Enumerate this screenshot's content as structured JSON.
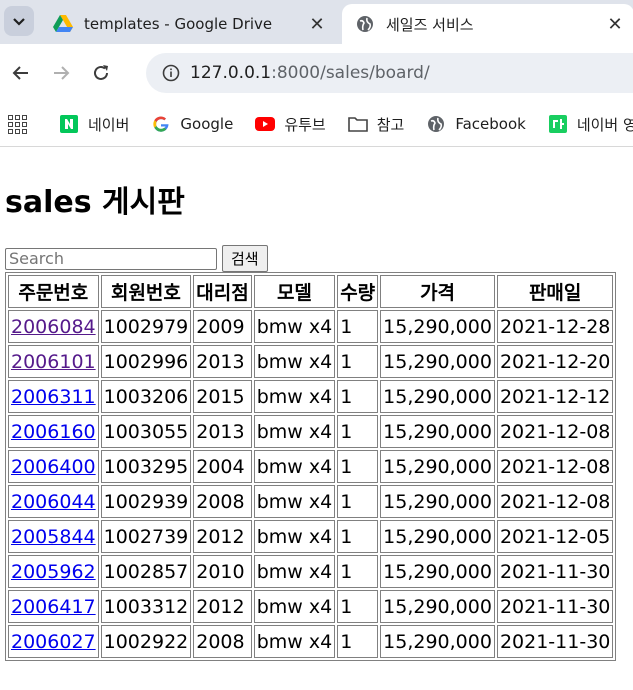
{
  "browser": {
    "tabs": [
      {
        "title": "templates - Google Drive",
        "favicon": "google-drive-icon",
        "active": false
      },
      {
        "title": "세일즈 서비스",
        "favicon": "globe-icon",
        "active": true
      }
    ],
    "url_host": "127.0.0.1",
    "url_rest": ":8000/sales/board/",
    "bookmarks": [
      {
        "label": "네이버",
        "icon": "naver-icon"
      },
      {
        "label": "Google",
        "icon": "google-icon"
      },
      {
        "label": "유투브",
        "icon": "youtube-icon"
      },
      {
        "label": "참고",
        "icon": "folder-icon"
      },
      {
        "label": "Facebook",
        "icon": "globe-icon"
      },
      {
        "label": "네이버 영",
        "icon": "naver-dict-icon"
      }
    ]
  },
  "page": {
    "title": "sales 게시판",
    "search": {
      "placeholder": "Search",
      "value": "",
      "button_label": "검색"
    },
    "table": {
      "headers": [
        "주문번호",
        "회원번호",
        "대리점",
        "모델",
        "수량",
        "가격",
        "판매일"
      ],
      "rows": [
        {
          "order_no": "2006084",
          "member_no": "1002979",
          "dealer": "2009",
          "model": "bmw x4",
          "qty": "1",
          "price": "15,290,000",
          "date": "2021-12-28",
          "visited": true
        },
        {
          "order_no": "2006101",
          "member_no": "1002996",
          "dealer": "2013",
          "model": "bmw x4",
          "qty": "1",
          "price": "15,290,000",
          "date": "2021-12-20",
          "visited": true
        },
        {
          "order_no": "2006311",
          "member_no": "1003206",
          "dealer": "2015",
          "model": "bmw x4",
          "qty": "1",
          "price": "15,290,000",
          "date": "2021-12-12",
          "visited": false
        },
        {
          "order_no": "2006160",
          "member_no": "1003055",
          "dealer": "2013",
          "model": "bmw x4",
          "qty": "1",
          "price": "15,290,000",
          "date": "2021-12-08",
          "visited": false
        },
        {
          "order_no": "2006400",
          "member_no": "1003295",
          "dealer": "2004",
          "model": "bmw x4",
          "qty": "1",
          "price": "15,290,000",
          "date": "2021-12-08",
          "visited": false
        },
        {
          "order_no": "2006044",
          "member_no": "1002939",
          "dealer": "2008",
          "model": "bmw x4",
          "qty": "1",
          "price": "15,290,000",
          "date": "2021-12-08",
          "visited": false
        },
        {
          "order_no": "2005844",
          "member_no": "1002739",
          "dealer": "2012",
          "model": "bmw x4",
          "qty": "1",
          "price": "15,290,000",
          "date": "2021-12-05",
          "visited": false
        },
        {
          "order_no": "2005962",
          "member_no": "1002857",
          "dealer": "2010",
          "model": "bmw x4",
          "qty": "1",
          "price": "15,290,000",
          "date": "2021-11-30",
          "visited": false
        },
        {
          "order_no": "2006417",
          "member_no": "1003312",
          "dealer": "2012",
          "model": "bmw x4",
          "qty": "1",
          "price": "15,290,000",
          "date": "2021-11-30",
          "visited": false
        },
        {
          "order_no": "2006027",
          "member_no": "1002922",
          "dealer": "2008",
          "model": "bmw x4",
          "qty": "1",
          "price": "15,290,000",
          "date": "2021-11-30",
          "visited": false
        }
      ]
    }
  },
  "colors": {
    "link": "#0000ee",
    "visited_link": "#551a8b",
    "tabbar_bg": "#dfe3eb"
  }
}
